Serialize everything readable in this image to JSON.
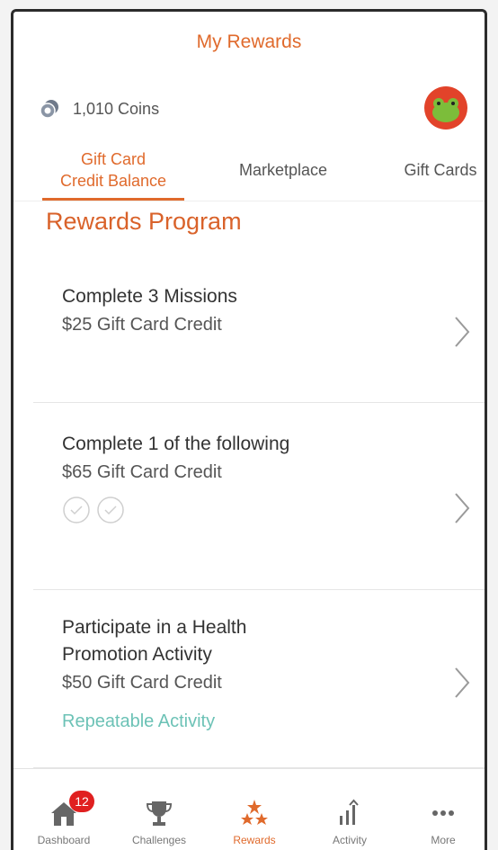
{
  "header": {
    "title": "My Rewards"
  },
  "coins": {
    "label": "1,010 Coins",
    "icon": "coins-icon"
  },
  "tabs": [
    {
      "line1": "Gift Card",
      "line2": "Credit Balance",
      "active": true
    },
    {
      "label": "Marketplace",
      "active": false
    },
    {
      "label": "Gift Cards",
      "active": false
    }
  ],
  "section": {
    "title": "Rewards Program"
  },
  "cards": [
    {
      "title": "Complete 3 Missions",
      "subtitle": "$25 Gift Card Credit"
    },
    {
      "title": "Complete 1 of the following",
      "subtitle": "$65 Gift Card Credit"
    },
    {
      "title_line1": "Participate in a Health",
      "title_line2": "Promotion Activity",
      "subtitle": "$50 Gift Card Credit",
      "note": "Repeatable Activity"
    }
  ],
  "tabbar": {
    "items": [
      {
        "label": "Dashboard",
        "icon": "home-icon",
        "badge": "12"
      },
      {
        "label": "Challenges",
        "icon": "trophy-icon"
      },
      {
        "label": "Rewards",
        "icon": "stars-icon",
        "active": true
      },
      {
        "label": "Activity",
        "icon": "activity-chart-icon"
      },
      {
        "label": "More",
        "icon": "more-dots-icon"
      }
    ]
  },
  "colors": {
    "accent": "#e06a2c",
    "teal": "#6cc2b6",
    "badge": "#e02020"
  }
}
